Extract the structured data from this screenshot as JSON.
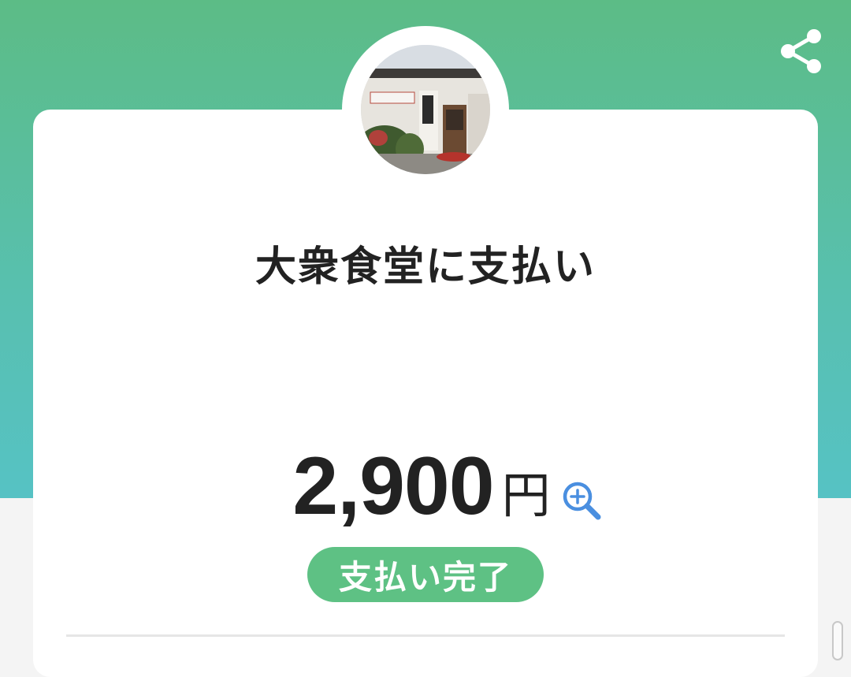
{
  "merchant": {
    "title": "大衆食堂に支払い"
  },
  "payment": {
    "amount": "2,900",
    "currency": "円",
    "status": "支払い完了"
  },
  "icons": {
    "share": "share-icon",
    "zoom": "zoom-in-icon"
  },
  "colors": {
    "header_top": "#5cbc86",
    "header_bottom": "#56c2c4",
    "status_badge": "#5ec184",
    "zoom_icon": "#4a8fe0"
  }
}
